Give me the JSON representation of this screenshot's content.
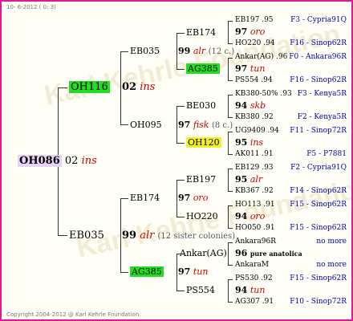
{
  "header": {
    "date": "10- 6-2012 ( 0: 3)"
  },
  "footer": {
    "copyright": "Copyright 2004-2012 @ Karl Kehrle Foundation."
  },
  "watermark": {
    "text": "Karl Kehrle Foundation"
  },
  "colors": {
    "frame": "#e0199a",
    "green": "#22dd22",
    "yellow": "#f3f31f",
    "lavender": "#e8d3f5",
    "red": "#cc0000",
    "blue": "#0000aa"
  },
  "root": {
    "name": "OH086",
    "gen": "02",
    "tag": "ins"
  },
  "father": {
    "name": "OH116",
    "gen": "02",
    "tag": "ins"
  },
  "mother": {
    "name": "EB035",
    "gen": "99",
    "tag": "alr",
    "note": "(12 sister colonies)"
  },
  "ff": {
    "name": "EB035",
    "gen": "99",
    "tag": "alr",
    "note": "(12 c.)"
  },
  "fm": {
    "name": "OH095",
    "gen": "97",
    "tag": "fisk",
    "note": "(8 c.)"
  },
  "mf": {
    "name": "EB174",
    "gen": "97",
    "tag": "oro"
  },
  "mm": {
    "name": "AG385",
    "gen": "97",
    "tag": "tun"
  },
  "g3": [
    {
      "name": "EB174"
    },
    {
      "name": "AG385"
    },
    {
      "name": "BE030"
    },
    {
      "name": "OH120"
    },
    {
      "name": "EB197"
    },
    {
      "name": "HO220"
    },
    {
      "name": "Ankar(AG)"
    },
    {
      "name": "PS554"
    }
  ],
  "g4": [
    {
      "top": "EB197 .95",
      "gen": "97",
      "tag": "oro",
      "bottom": "HO220 .94",
      "r1": "F3 - Cypria91Q",
      "r2": "F16 - Sinop62R"
    },
    {
      "top": "Ankar(AG) .96",
      "gen": "97",
      "tag": "tun",
      "bottom": "PS554 .94",
      "r1": "F0 - Ankara96R",
      "r2": "F16 - Sinop62R"
    },
    {
      "top": "KB380-50% .93",
      "gen": "94",
      "tag": "skb",
      "bottom": "KB380 .92",
      "r1": "F3 - Kenya5R",
      "r2": "F2 - Kenya5R"
    },
    {
      "top": "UG9409 .94",
      "gen": "95",
      "tag": "ins",
      "bottom": "AK011 .91",
      "r1": "F11 - Sinop72R",
      "r2": "F5 - P7881"
    },
    {
      "top": "EB129 .93",
      "gen": "95",
      "tag": "alr",
      "bottom": "KB367 .92",
      "r1": "F2 - Cypria91Q",
      "r2": "F14 - Sinop62R"
    },
    {
      "top": "HO113 .91",
      "gen": "94",
      "tag": "oro",
      "bottom": "HO050 .91",
      "r1": "F15 - Sinop62R",
      "r2": "F15 - Sinop62R"
    },
    {
      "top": "Ankara96R",
      "gen": "96",
      "tag": "pure anatolica",
      "bottom": "AnkaraM",
      "r1": "no more",
      "r2": "no more"
    },
    {
      "top": "PS530 .92",
      "gen": "94",
      "tag": "tun",
      "bottom": "AG307 .91",
      "r1": "F15 - Sinop62R",
      "r2": "F10 - Sinop72R"
    }
  ]
}
